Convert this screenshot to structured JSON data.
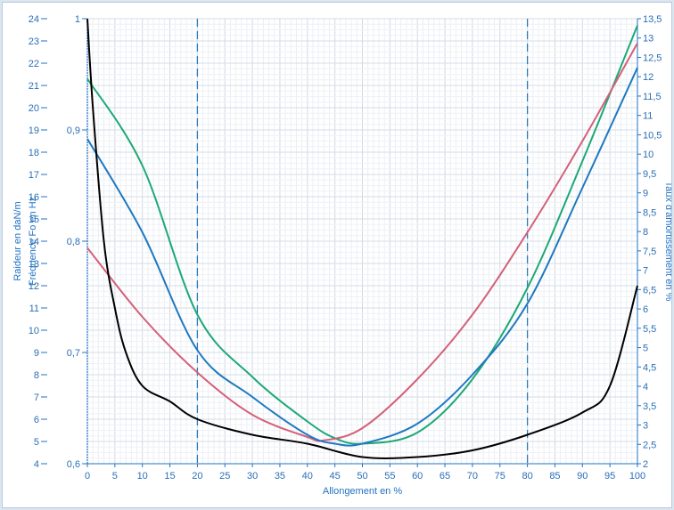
{
  "chart_data": {
    "type": "line",
    "xlabel": "Allongement en %",
    "ylabel_left_outer": "Raideur  en daN/m",
    "ylabel_left_inner": "Fréquence  Fo en Hz",
    "ylabel_right": "Taux d'amortissement en %",
    "x_ticks": [
      0,
      5,
      10,
      15,
      20,
      25,
      30,
      35,
      40,
      45,
      50,
      55,
      60,
      65,
      70,
      75,
      80,
      85,
      90,
      95,
      100
    ],
    "x_range": [
      0,
      100
    ],
    "y_left_outer": {
      "range": [
        4,
        24
      ],
      "ticks": [
        4,
        5,
        6,
        7,
        8,
        9,
        10,
        11,
        12,
        13,
        14,
        15,
        16,
        17,
        18,
        19,
        20,
        21,
        22,
        23,
        24
      ]
    },
    "y_left_inner": {
      "range": [
        0.6,
        1.0
      ],
      "ticks": [
        "0,6",
        "0,7",
        "0,8",
        "0,9",
        "1"
      ]
    },
    "y_right": {
      "range": [
        2,
        13.5
      ],
      "ticks": [
        "2",
        "2,5",
        "3",
        "3,5",
        "4",
        "4,5",
        "5",
        "5,5",
        "6",
        "6,5",
        "7",
        "7,5",
        "8",
        "8,5",
        "9",
        "9,5",
        "10",
        "10,5",
        "11",
        "11,5",
        "12",
        "12,5",
        "13",
        "13,5"
      ]
    },
    "vertical_markers": [
      20,
      80
    ],
    "grid": true,
    "colors": {
      "green": "#1ea876",
      "pink": "#d4607a",
      "blue": "#1e78c0",
      "black": "#000000",
      "axis": "#1f73c4",
      "marker": "#2a7bbf",
      "grid": "#dfe5ec"
    },
    "series": [
      {
        "color": "green",
        "axis": "y_left_outer",
        "x": [
          0,
          10,
          20,
          30,
          40,
          45,
          50,
          60,
          70,
          80,
          90,
          100
        ],
        "y": [
          21.3,
          17.4,
          10.7,
          7.9,
          5.9,
          5.15,
          4.9,
          5.4,
          7.8,
          11.9,
          17.6,
          23.7
        ]
      },
      {
        "color": "pink",
        "axis": "y_left_outer",
        "x": [
          0,
          10,
          20,
          30,
          40,
          43,
          50,
          60,
          70,
          80,
          90,
          100
        ],
        "y": [
          13.7,
          10.6,
          8.1,
          6.2,
          5.2,
          5.05,
          5.6,
          7.8,
          10.7,
          14.4,
          18.5,
          22.9
        ]
      },
      {
        "color": "blue",
        "axis": "y_left_outer",
        "x": [
          0,
          10,
          20,
          30,
          40,
          45,
          50,
          60,
          70,
          80,
          90,
          100
        ],
        "y": [
          18.6,
          14.4,
          9.1,
          7.0,
          5.3,
          4.9,
          4.9,
          5.8,
          8.0,
          11.2,
          16.4,
          21.8
        ]
      },
      {
        "color": "black",
        "axis": "y_left_outer",
        "x": [
          0,
          1,
          3,
          5,
          7,
          10,
          15,
          20,
          30,
          40,
          50,
          60,
          70,
          80,
          90,
          95,
          100
        ],
        "y": [
          24,
          20,
          14.0,
          11.0,
          9.0,
          7.5,
          6.8,
          6.0,
          5.3,
          4.9,
          4.3,
          4.3,
          4.6,
          5.3,
          6.3,
          7.5,
          12.0
        ]
      }
    ]
  }
}
